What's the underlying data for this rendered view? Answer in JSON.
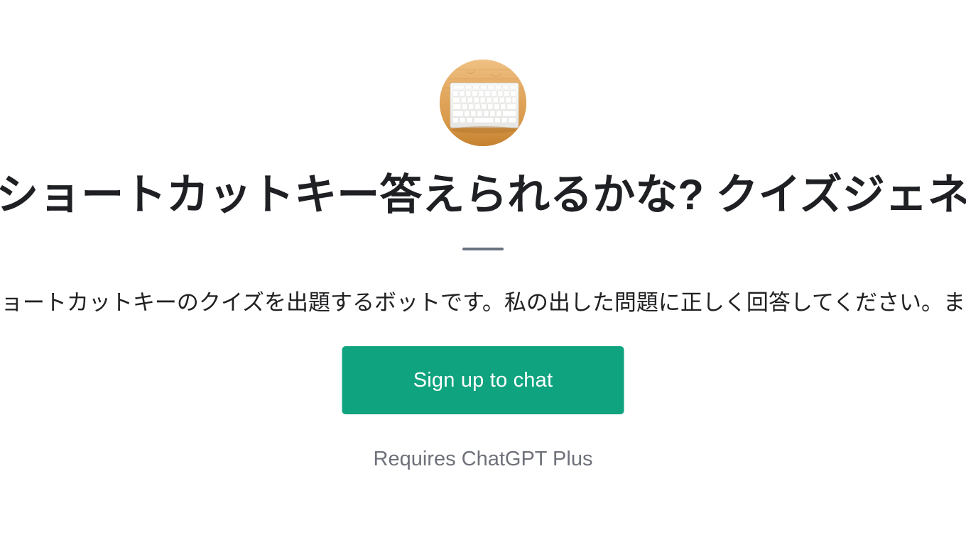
{
  "page": {
    "background_color": "#ffffff"
  },
  "avatar": {
    "icon_name": "keyboard-on-wooden-desk-photo",
    "alt": "White keyboard on a wooden desk",
    "wood_color": "#d9963f",
    "wood_light_color": "#f3c98a",
    "keyboard_color": "#f7f7f5"
  },
  "header": {
    "title": "ショートカットキー答えられるかな? クイズジェネ",
    "title_color": "#1f2024"
  },
  "divider": {
    "color": "#6b7280"
  },
  "description": {
    "text": "ョートカットキーのクイズを出題するボットです。私の出した問題に正しく回答してください。ま",
    "color": "#202123"
  },
  "cta": {
    "label": "Sign up to chat",
    "background_color": "#10a37f",
    "text_color": "#ffffff"
  },
  "footer": {
    "note": "Requires ChatGPT Plus",
    "color": "#6e7179"
  }
}
